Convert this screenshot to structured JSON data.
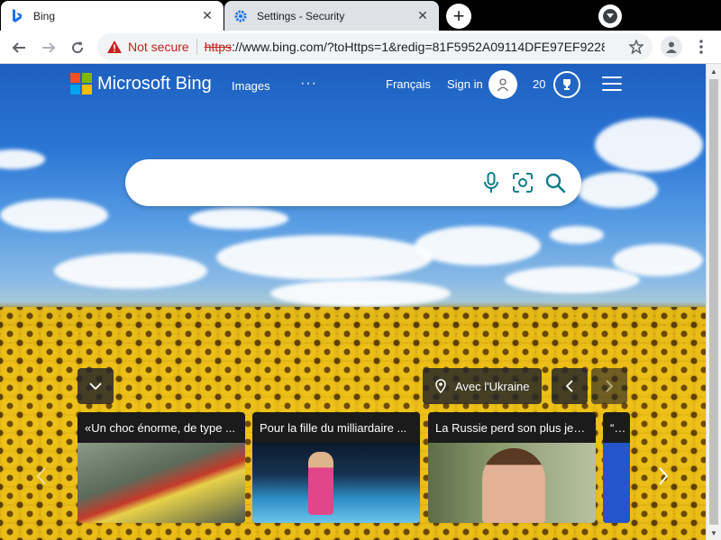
{
  "browser": {
    "tabs": [
      {
        "title": "Bing",
        "icon": "bing-icon",
        "active": true
      },
      {
        "title": "Settings - Security",
        "icon": "gear-icon",
        "active": false
      }
    ],
    "omnibox": {
      "security_label": "Not secure",
      "scheme": "https",
      "url_rest": "://www.bing.com/?toHttps=1&redig=81F5952A09114DFE97EF9228..."
    }
  },
  "bing": {
    "brand": "Microsoft Bing",
    "nav_images": "Images",
    "nav_more": "···",
    "language": "Français",
    "sign_in": "Sign in",
    "rewards_count": "20",
    "search_placeholder": "",
    "ukraine_label": "Avec l'Ukraine",
    "cards": [
      {
        "title": "«Un choc énorme, de type ...",
        "thumb_color": "#6b7a6a"
      },
      {
        "title": "Pour la fille du milliardaire ...",
        "thumb_color": "#2e8fc7"
      },
      {
        "title": "La Russie perd son plus jeu...",
        "thumb_color": "#7d8b62"
      },
      {
        "title": "“Jus",
        "thumb_color": "#2456c9"
      }
    ]
  },
  "colors": {
    "ms_red": "#f25022",
    "ms_green": "#7fba00",
    "ms_blue": "#00a4ef",
    "ms_yellow": "#ffb900",
    "bing_teal": "#0f7c8a",
    "not_secure_red": "#c5221f"
  }
}
